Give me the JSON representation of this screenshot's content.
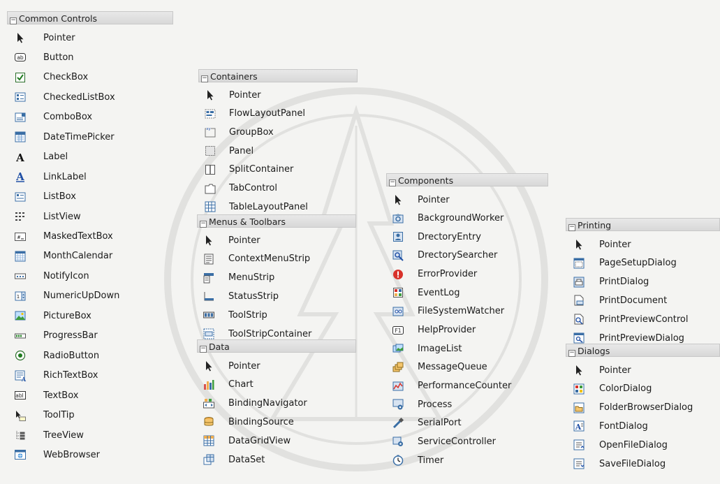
{
  "groups": {
    "common": {
      "title": "Common Controls",
      "items": [
        {
          "label": "Pointer",
          "icon": "pointer-icon"
        },
        {
          "label": "Button",
          "icon": "button-icon"
        },
        {
          "label": "CheckBox",
          "icon": "checkbox-icon"
        },
        {
          "label": "CheckedListBox",
          "icon": "checkedlistbox-icon"
        },
        {
          "label": "ComboBox",
          "icon": "combobox-icon"
        },
        {
          "label": "DateTimePicker",
          "icon": "datetimepicker-icon"
        },
        {
          "label": "Label",
          "icon": "label-icon"
        },
        {
          "label": "LinkLabel",
          "icon": "linklabel-icon"
        },
        {
          "label": "ListBox",
          "icon": "listbox-icon"
        },
        {
          "label": "ListView",
          "icon": "listview-icon"
        },
        {
          "label": "MaskedTextBox",
          "icon": "maskedtextbox-icon"
        },
        {
          "label": "MonthCalendar",
          "icon": "monthcalendar-icon"
        },
        {
          "label": "NotifyIcon",
          "icon": "notifyicon-icon"
        },
        {
          "label": "NumericUpDown",
          "icon": "numericupdown-icon"
        },
        {
          "label": "PictureBox",
          "icon": "picturebox-icon"
        },
        {
          "label": "ProgressBar",
          "icon": "progressbar-icon"
        },
        {
          "label": "RadioButton",
          "icon": "radiobutton-icon"
        },
        {
          "label": "RichTextBox",
          "icon": "richtextbox-icon"
        },
        {
          "label": "TextBox",
          "icon": "textbox-icon"
        },
        {
          "label": "ToolTip",
          "icon": "tooltip-icon"
        },
        {
          "label": "TreeView",
          "icon": "treeview-icon"
        },
        {
          "label": "WebBrowser",
          "icon": "webbrowser-icon"
        }
      ]
    },
    "containers": {
      "title": "Containers",
      "items": [
        {
          "label": "Pointer",
          "icon": "pointer-icon"
        },
        {
          "label": "FlowLayoutPanel",
          "icon": "flowlayoutpanel-icon"
        },
        {
          "label": "GroupBox",
          "icon": "groupbox-icon"
        },
        {
          "label": "Panel",
          "icon": "panel-icon"
        },
        {
          "label": "SplitContainer",
          "icon": "splitcontainer-icon"
        },
        {
          "label": "TabControl",
          "icon": "tabcontrol-icon"
        },
        {
          "label": "TableLayoutPanel",
          "icon": "tablelayoutpanel-icon"
        }
      ]
    },
    "menus": {
      "title": "Menus & Toolbars",
      "items": [
        {
          "label": "Pointer",
          "icon": "pointer-icon"
        },
        {
          "label": "ContextMenuStrip",
          "icon": "contextmenustrip-icon"
        },
        {
          "label": "MenuStrip",
          "icon": "menustrip-icon"
        },
        {
          "label": "StatusStrip",
          "icon": "statusstrip-icon"
        },
        {
          "label": "ToolStrip",
          "icon": "toolstrip-icon"
        },
        {
          "label": "ToolStripContainer",
          "icon": "toolstripcontainer-icon"
        }
      ]
    },
    "data": {
      "title": "Data",
      "items": [
        {
          "label": "Pointer",
          "icon": "pointer-icon"
        },
        {
          "label": "Chart",
          "icon": "chart-icon"
        },
        {
          "label": "BindingNavigator",
          "icon": "bindingnavigator-icon"
        },
        {
          "label": "BindingSource",
          "icon": "bindingsource-icon"
        },
        {
          "label": "DataGridView",
          "icon": "datagridview-icon"
        },
        {
          "label": "DataSet",
          "icon": "dataset-icon"
        }
      ]
    },
    "components": {
      "title": "Components",
      "items": [
        {
          "label": "Pointer",
          "icon": "pointer-icon"
        },
        {
          "label": "BackgroundWorker",
          "icon": "backgroundworker-icon"
        },
        {
          "label": "DrectoryEntry",
          "icon": "directoryentry-icon"
        },
        {
          "label": "DrectorySearcher",
          "icon": "directorysearcher-icon"
        },
        {
          "label": "ErrorProvider",
          "icon": "errorprovider-icon"
        },
        {
          "label": "EventLog",
          "icon": "eventlog-icon"
        },
        {
          "label": "FileSystemWatcher",
          "icon": "filesystemwatcher-icon"
        },
        {
          "label": "HelpProvider",
          "icon": "helpprovider-icon"
        },
        {
          "label": "ImageList",
          "icon": "imagelist-icon"
        },
        {
          "label": "MessageQueue",
          "icon": "messagequeue-icon"
        },
        {
          "label": "PerformanceCounter",
          "icon": "performancecounter-icon"
        },
        {
          "label": "Process",
          "icon": "process-icon"
        },
        {
          "label": "SerialPort",
          "icon": "serialport-icon"
        },
        {
          "label": "ServiceController",
          "icon": "servicecontroller-icon"
        },
        {
          "label": "Timer",
          "icon": "timer-icon"
        }
      ]
    },
    "printing": {
      "title": "Printing",
      "items": [
        {
          "label": "Pointer",
          "icon": "pointer-icon"
        },
        {
          "label": "PageSetupDialog",
          "icon": "pagesetupdialog-icon"
        },
        {
          "label": "PrintDialog",
          "icon": "printdialog-icon"
        },
        {
          "label": "PrintDocument",
          "icon": "printdocument-icon"
        },
        {
          "label": "PrintPreviewControl",
          "icon": "printpreviewcontrol-icon"
        },
        {
          "label": "PrintPreviewDialog",
          "icon": "printpreviewdialog-icon"
        }
      ]
    },
    "dialogs": {
      "title": "Dialogs",
      "items": [
        {
          "label": "Pointer",
          "icon": "pointer-icon"
        },
        {
          "label": "ColorDialog",
          "icon": "colordialog-icon"
        },
        {
          "label": "FolderBrowserDialog",
          "icon": "folderbrowserdialog-icon"
        },
        {
          "label": "FontDialog",
          "icon": "fontdialog-icon"
        },
        {
          "label": "OpenFileDialog",
          "icon": "openfiledialog-icon"
        },
        {
          "label": "SaveFileDialog",
          "icon": "savefiledialog-icon"
        }
      ]
    }
  }
}
